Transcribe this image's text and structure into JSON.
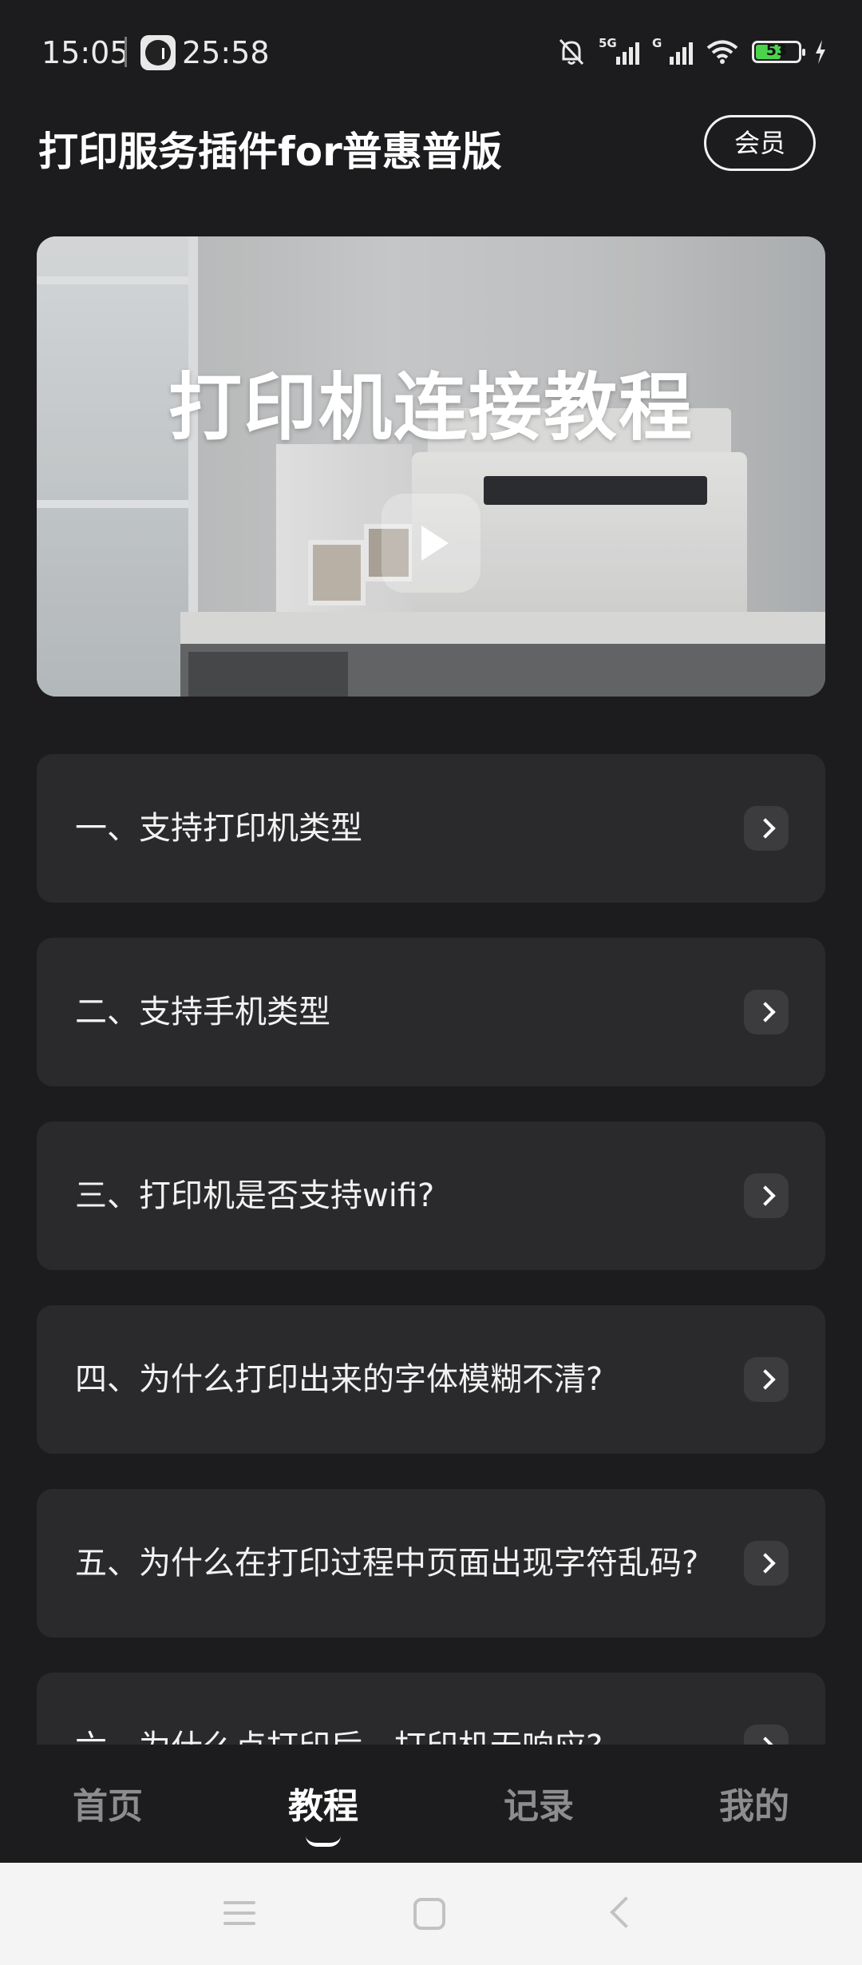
{
  "status_bar": {
    "time": "15:05",
    "timer": "25:58",
    "signal1_tag": "5G",
    "signal2_tag": "G",
    "battery_level": "53",
    "icons": [
      "timer-icon",
      "mute-icon",
      "signal-icon",
      "wifi-icon",
      "battery-icon",
      "charging-icon"
    ]
  },
  "header": {
    "title": "打印服务插件for普惠普版",
    "member_button": "会员"
  },
  "banner": {
    "title": "打印机连接教程",
    "icon": "play-icon"
  },
  "faq_items": [
    {
      "label": "一、支持打印机类型"
    },
    {
      "label": "二、支持手机类型"
    },
    {
      "label": "三、打印机是否支持wifi?"
    },
    {
      "label": "四、为什么打印出来的字体模糊不清?"
    },
    {
      "label": "五、为什么在打印过程中页面出现字符乱码?"
    },
    {
      "label": "六、为什么点打印后，打印机无响应?"
    }
  ],
  "tabs": [
    {
      "label": "首页",
      "active": false
    },
    {
      "label": "教程",
      "active": true
    },
    {
      "label": "记录",
      "active": false
    },
    {
      "label": "我的",
      "active": false
    }
  ],
  "colors": {
    "background": "#1c1c1e",
    "card": "#2a2a2c",
    "battery_fill": "#4cd34c"
  }
}
